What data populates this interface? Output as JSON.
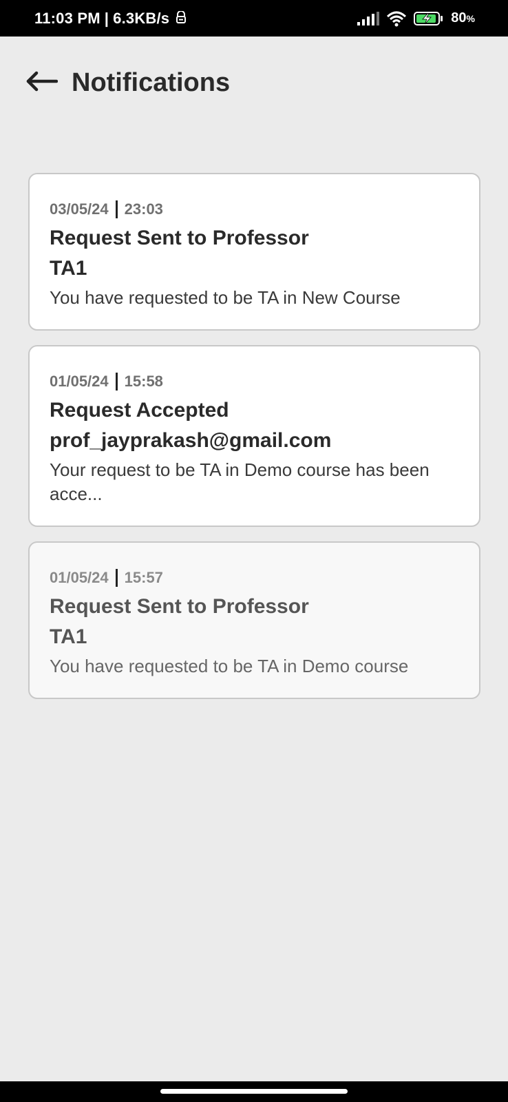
{
  "status_bar": {
    "time": "11:03 PM",
    "separator": "|",
    "network_speed": "6.3KB/s",
    "battery_percent": "80",
    "battery_unit": "%",
    "icons": [
      "vpn-icon",
      "signal-icon",
      "wifi-icon",
      "battery-charging-icon"
    ]
  },
  "header": {
    "back_icon": "arrow-left-icon",
    "title": "Notifications"
  },
  "notifications": [
    {
      "date": "03/05/24",
      "time": "23:03",
      "title": "Request Sent to Professor",
      "sender": "TA1",
      "body": "You have requested to be TA in New Course",
      "read": false
    },
    {
      "date": "01/05/24",
      "time": "15:58",
      "title": "Request Accepted",
      "sender": "prof_jayprakash@gmail.com",
      "body": "Your request to be TA in Demo course has been acce...",
      "read": false
    },
    {
      "date": "01/05/24",
      "time": "15:57",
      "title": "Request Sent to Professor",
      "sender": "TA1",
      "body": "You have requested to be TA in Demo course",
      "read": true
    }
  ],
  "colors": {
    "background": "#ebebeb",
    "card": "#ffffff",
    "card_read": "#f8f8f8",
    "border": "#c8c8c8",
    "text_primary": "#2a2a2a",
    "text_meta": "#707070"
  }
}
